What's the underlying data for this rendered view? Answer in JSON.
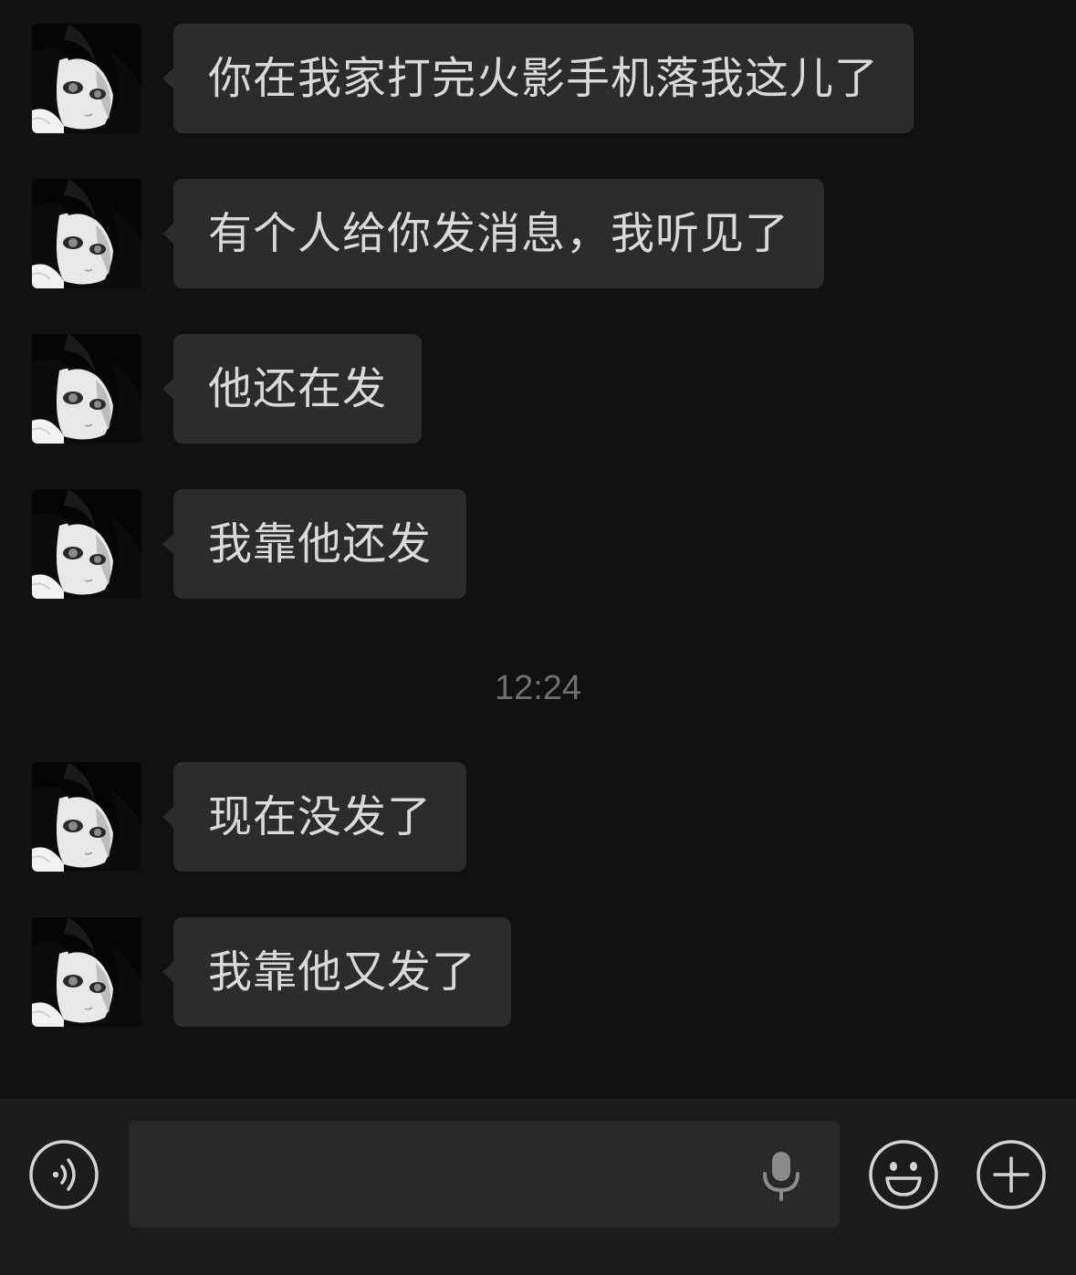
{
  "messages": [
    {
      "text": "你在我家打完火影手机落我这儿了"
    },
    {
      "text": "有个人给你发消息，我听见了"
    },
    {
      "text": "他还在发"
    },
    {
      "text": "我靠他还发"
    },
    {
      "text": "现在没发了"
    },
    {
      "text": "我靠他又发了"
    }
  ],
  "timestamp": "12:24",
  "input": {
    "value": "",
    "placeholder": ""
  },
  "icons": {
    "voice_toggle": "voice-icon",
    "microphone": "microphone-icon",
    "emoji": "emoji-icon",
    "more": "plus-icon"
  },
  "colors": {
    "background": "#111111",
    "bubble": "#2c2c2c",
    "bubble_text": "#d9d9d9",
    "timestamp": "#6f6f6f",
    "input_bar": "#1c1c1c"
  }
}
